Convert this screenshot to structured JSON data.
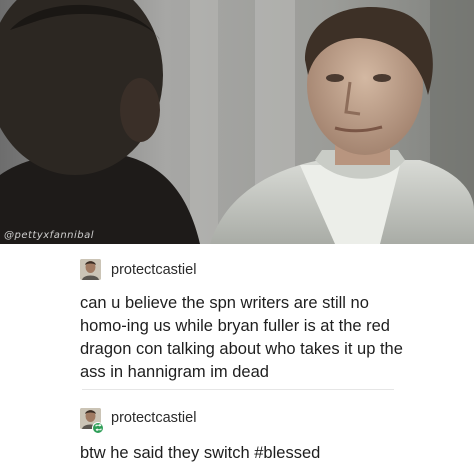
{
  "image": {
    "watermark": "@pettyxfannibal"
  },
  "posts": [
    {
      "username": "protectcastiel",
      "text": "can u believe the spn writers are still no homo-ing us while bryan fuller is at the red dragon con talking about who takes it up the ass in hannigram im dead",
      "avatar_icon": "user-avatar"
    },
    {
      "username": "protectcastiel",
      "text": "btw he said they switch #blessed",
      "avatar_icon": "user-avatar",
      "badge_icon": "reblog-icon",
      "badge_color": "#2e9e57"
    }
  ]
}
